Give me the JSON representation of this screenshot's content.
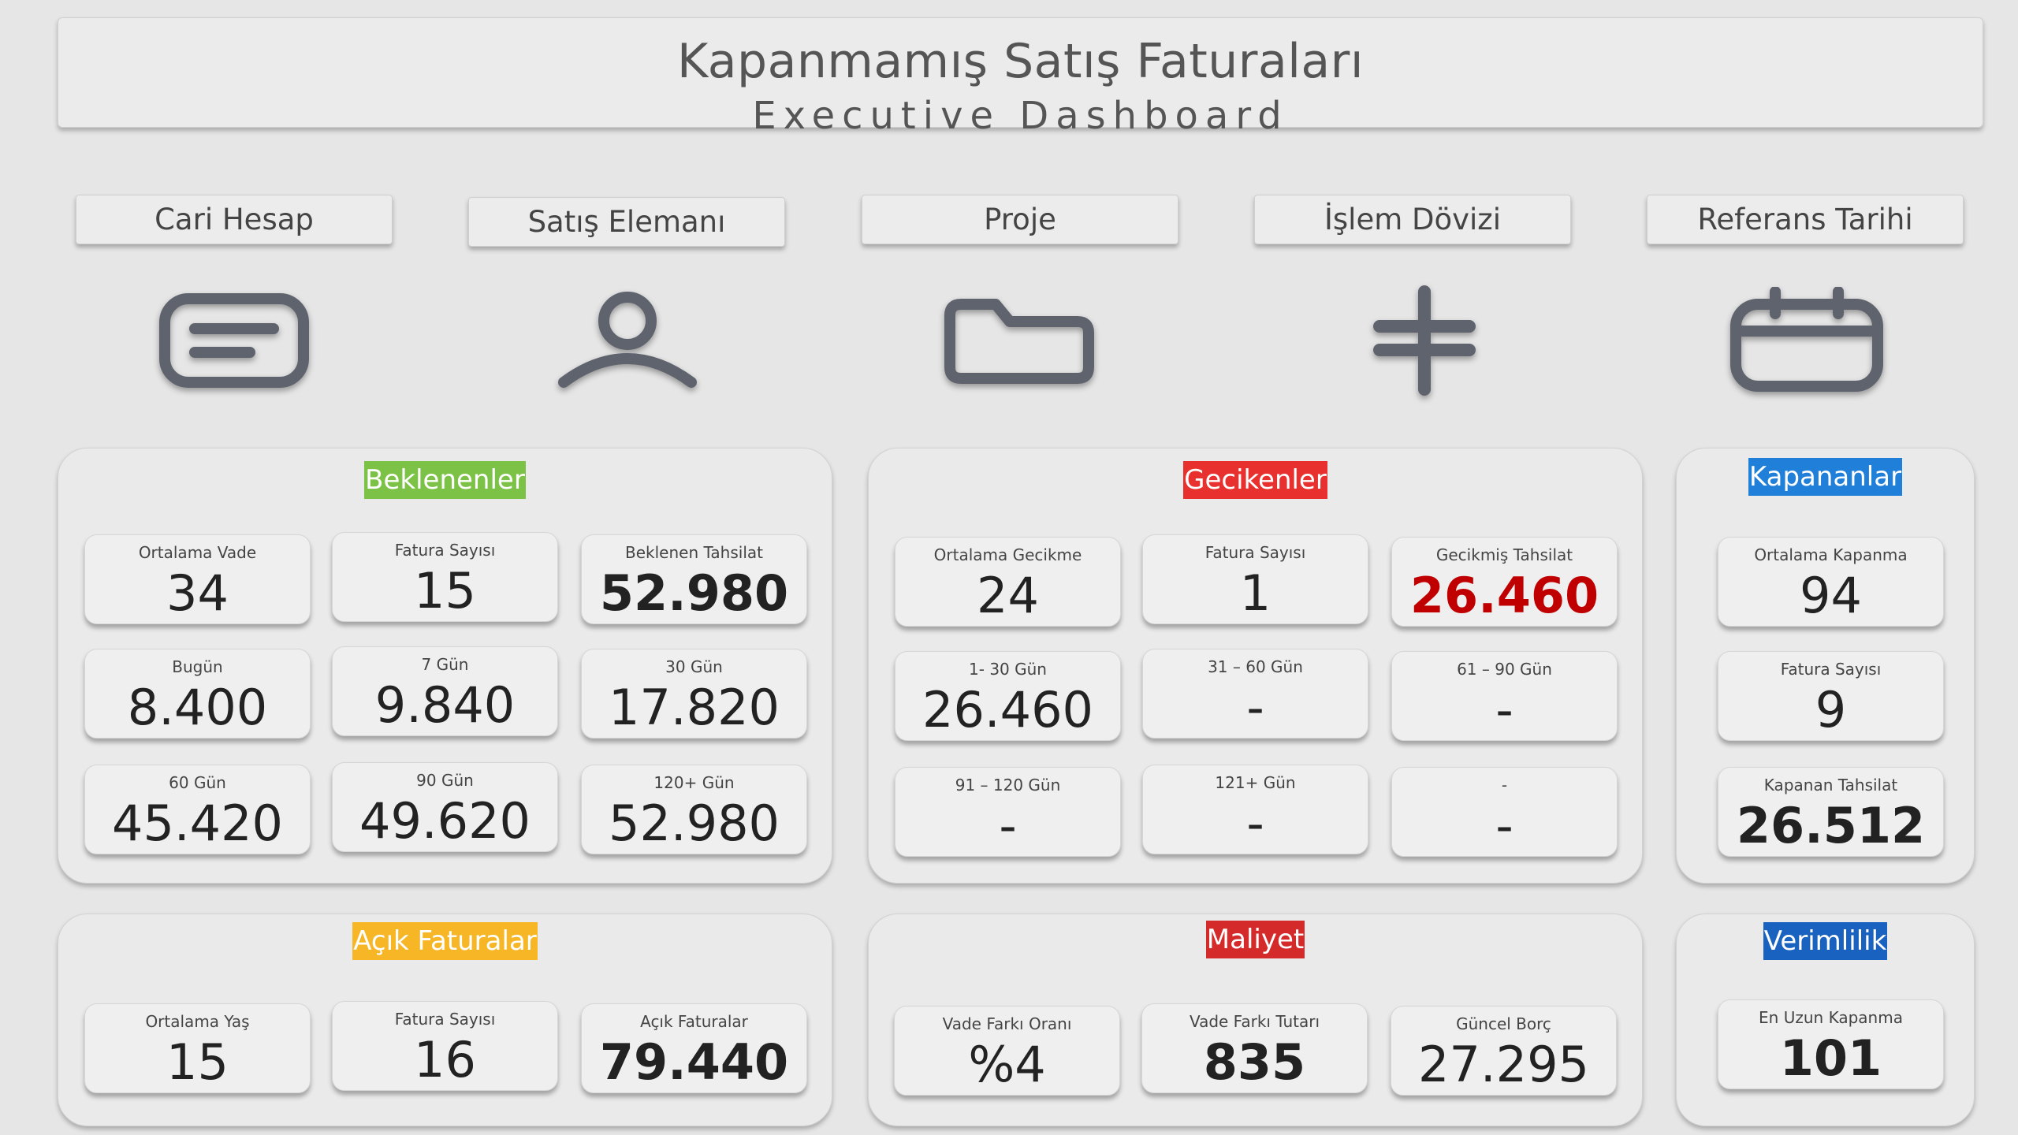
{
  "header": {
    "title": "Kapanmamış Satış Faturaları",
    "subtitle": "Executive Dashboard"
  },
  "filters": [
    {
      "label": "Cari Hesap",
      "icon": "card-icon"
    },
    {
      "label": "Satış Elemanı",
      "icon": "person-icon"
    },
    {
      "label": "Proje",
      "icon": "folder-icon"
    },
    {
      "label": "İşlem Dövizi",
      "icon": "currency-icon"
    },
    {
      "label": "Referans Tarihi",
      "icon": "calendar-icon"
    }
  ],
  "colors": {
    "beklenenler": "#7cc246",
    "gecikenler": "#e8312e",
    "kapananlar": "#1f7fd9",
    "acik": "#f6b625",
    "maliyet": "#d42a2a",
    "verimlilik": "#1a62bf",
    "overdue_value": "#c00000"
  },
  "panels": {
    "beklenenler": {
      "title": "Beklenenler",
      "cards": [
        {
          "label": "Ortalama Vade",
          "value": "34"
        },
        {
          "label": "Fatura Sayısı",
          "value": "15"
        },
        {
          "label": "Beklenen Tahsilat",
          "value": "52.980"
        },
        {
          "label": "Bugün",
          "value": "8.400"
        },
        {
          "label": "7 Gün",
          "value": "9.840"
        },
        {
          "label": "30 Gün",
          "value": "17.820"
        },
        {
          "label": "60 Gün",
          "value": "45.420"
        },
        {
          "label": "90 Gün",
          "value": "49.620"
        },
        {
          "label": "120+ Gün",
          "value": "52.980"
        }
      ]
    },
    "gecikenler": {
      "title": "Gecikenler",
      "cards": [
        {
          "label": "Ortalama Gecikme",
          "value": "24"
        },
        {
          "label": "Fatura Sayısı",
          "value": "1"
        },
        {
          "label": "Gecikmiş Tahsilat",
          "value": "26.460"
        },
        {
          "label": "1- 30 Gün",
          "value": "26.460"
        },
        {
          "label": "31 – 60 Gün",
          "value": "-"
        },
        {
          "label": "61 – 90 Gün",
          "value": "-"
        },
        {
          "label": "91 – 120 Gün",
          "value": "-"
        },
        {
          "label": "121+ Gün",
          "value": "-"
        },
        {
          "label": "-",
          "value": "-"
        }
      ]
    },
    "kapananlar": {
      "title": "Kapananlar",
      "cards": [
        {
          "label": "Ortalama Kapanma",
          "value": "94"
        },
        {
          "label": "Fatura Sayısı",
          "value": "9"
        },
        {
          "label": "Kapanan Tahsilat",
          "value": "26.512"
        }
      ]
    },
    "acik": {
      "title": "Açık Faturalar",
      "cards": [
        {
          "label": "Ortalama Yaş",
          "value": "15"
        },
        {
          "label": "Fatura Sayısı",
          "value": "16"
        },
        {
          "label": "Açık Faturalar",
          "value": "79.440"
        }
      ]
    },
    "maliyet": {
      "title": "Maliyet",
      "cards": [
        {
          "label": "Vade Farkı Oranı",
          "value": "%4"
        },
        {
          "label": "Vade Farkı Tutarı",
          "value": "835"
        },
        {
          "label": "Güncel Borç",
          "value": "27.295"
        }
      ]
    },
    "verimlilik": {
      "title": "Verimlilik",
      "cards": [
        {
          "label": "En Uzun Kapanma",
          "value": "101"
        }
      ]
    }
  }
}
